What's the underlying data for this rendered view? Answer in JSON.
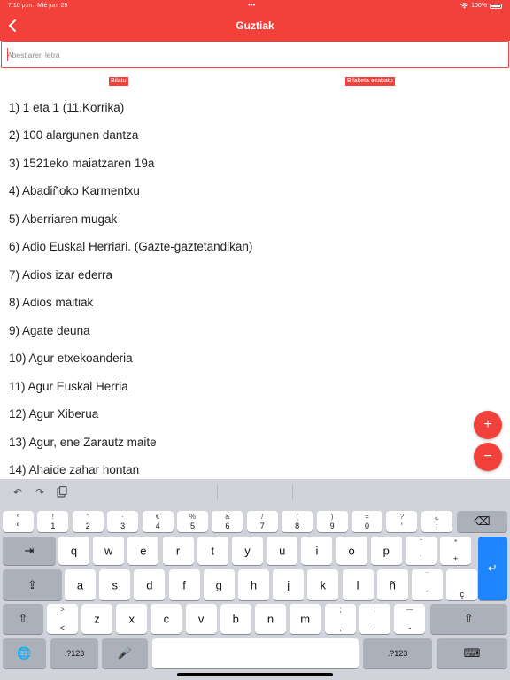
{
  "status_bar": {
    "time": "7:10 p.m.",
    "date": "Mié jun. 29",
    "battery": "100%"
  },
  "nav": {
    "title": "Guztiak"
  },
  "search": {
    "placeholder": "Abestiaren letra",
    "value": ""
  },
  "buttons": {
    "search": "Bilatu",
    "clear": "Bilaketa ezabatu"
  },
  "songs": [
    "1) 1 eta 1 (11.Korrika)",
    "2) 100 alargunen dantza",
    "3) 1521eko maiatzaren 19a",
    "4) Abadiñoko Karmentxu",
    "5) Aberriaren mugak",
    "6) Adio Euskal Herriari. (Gazte-gaztetandikan)",
    "7) Adios izar ederra",
    "8) Adios maitiak",
    "9) Agate deuna",
    "10) Agur etxekoanderia",
    "11) Agur Euskal Herria",
    "12) Agur Xiberua",
    "13) Agur, ene Zarautz maite",
    "14) Ahaide zahar hontan"
  ],
  "fab": {
    "add": "+",
    "remove": "−"
  },
  "keyboard": {
    "row1": [
      {
        "top": "ª",
        "bottom": "º"
      },
      {
        "top": "!",
        "bottom": "1"
      },
      {
        "top": "″",
        "bottom": "2"
      },
      {
        "top": "·",
        "bottom": "3"
      },
      {
        "top": "€",
        "bottom": "4"
      },
      {
        "top": "%",
        "bottom": "5"
      },
      {
        "top": "&",
        "bottom": "6"
      },
      {
        "top": "/",
        "bottom": "7"
      },
      {
        "top": "(",
        "bottom": "8"
      },
      {
        "top": ")",
        "bottom": "9"
      },
      {
        "top": "=",
        "bottom": "0"
      },
      {
        "top": "?",
        "bottom": "′"
      },
      {
        "top": "¿",
        "bottom": "¡"
      }
    ],
    "row2": [
      "q",
      "w",
      "e",
      "r",
      "t",
      "y",
      "u",
      "i",
      "o",
      "p"
    ],
    "row2_extra": [
      {
        "top": "ˆ",
        "bottom": "`"
      },
      {
        "top": "*",
        "bottom": "+"
      }
    ],
    "row3": [
      "a",
      "s",
      "d",
      "f",
      "g",
      "h",
      "j",
      "k",
      "l",
      "ñ"
    ],
    "row3_extra": [
      {
        "top": "¨",
        "bottom": "´"
      },
      {
        "top": "",
        "bottom": "ç"
      }
    ],
    "row4_sym": {
      "top": ">",
      "bottom": "<"
    },
    "row4": [
      "z",
      "x",
      "c",
      "v",
      "b",
      "n",
      "m"
    ],
    "row4_extra": [
      {
        "top": ";",
        "bottom": ","
      },
      {
        "top": ":",
        "bottom": "."
      },
      {
        "top": "—",
        "bottom": "-"
      }
    ],
    "numbers_label": ".?123"
  }
}
